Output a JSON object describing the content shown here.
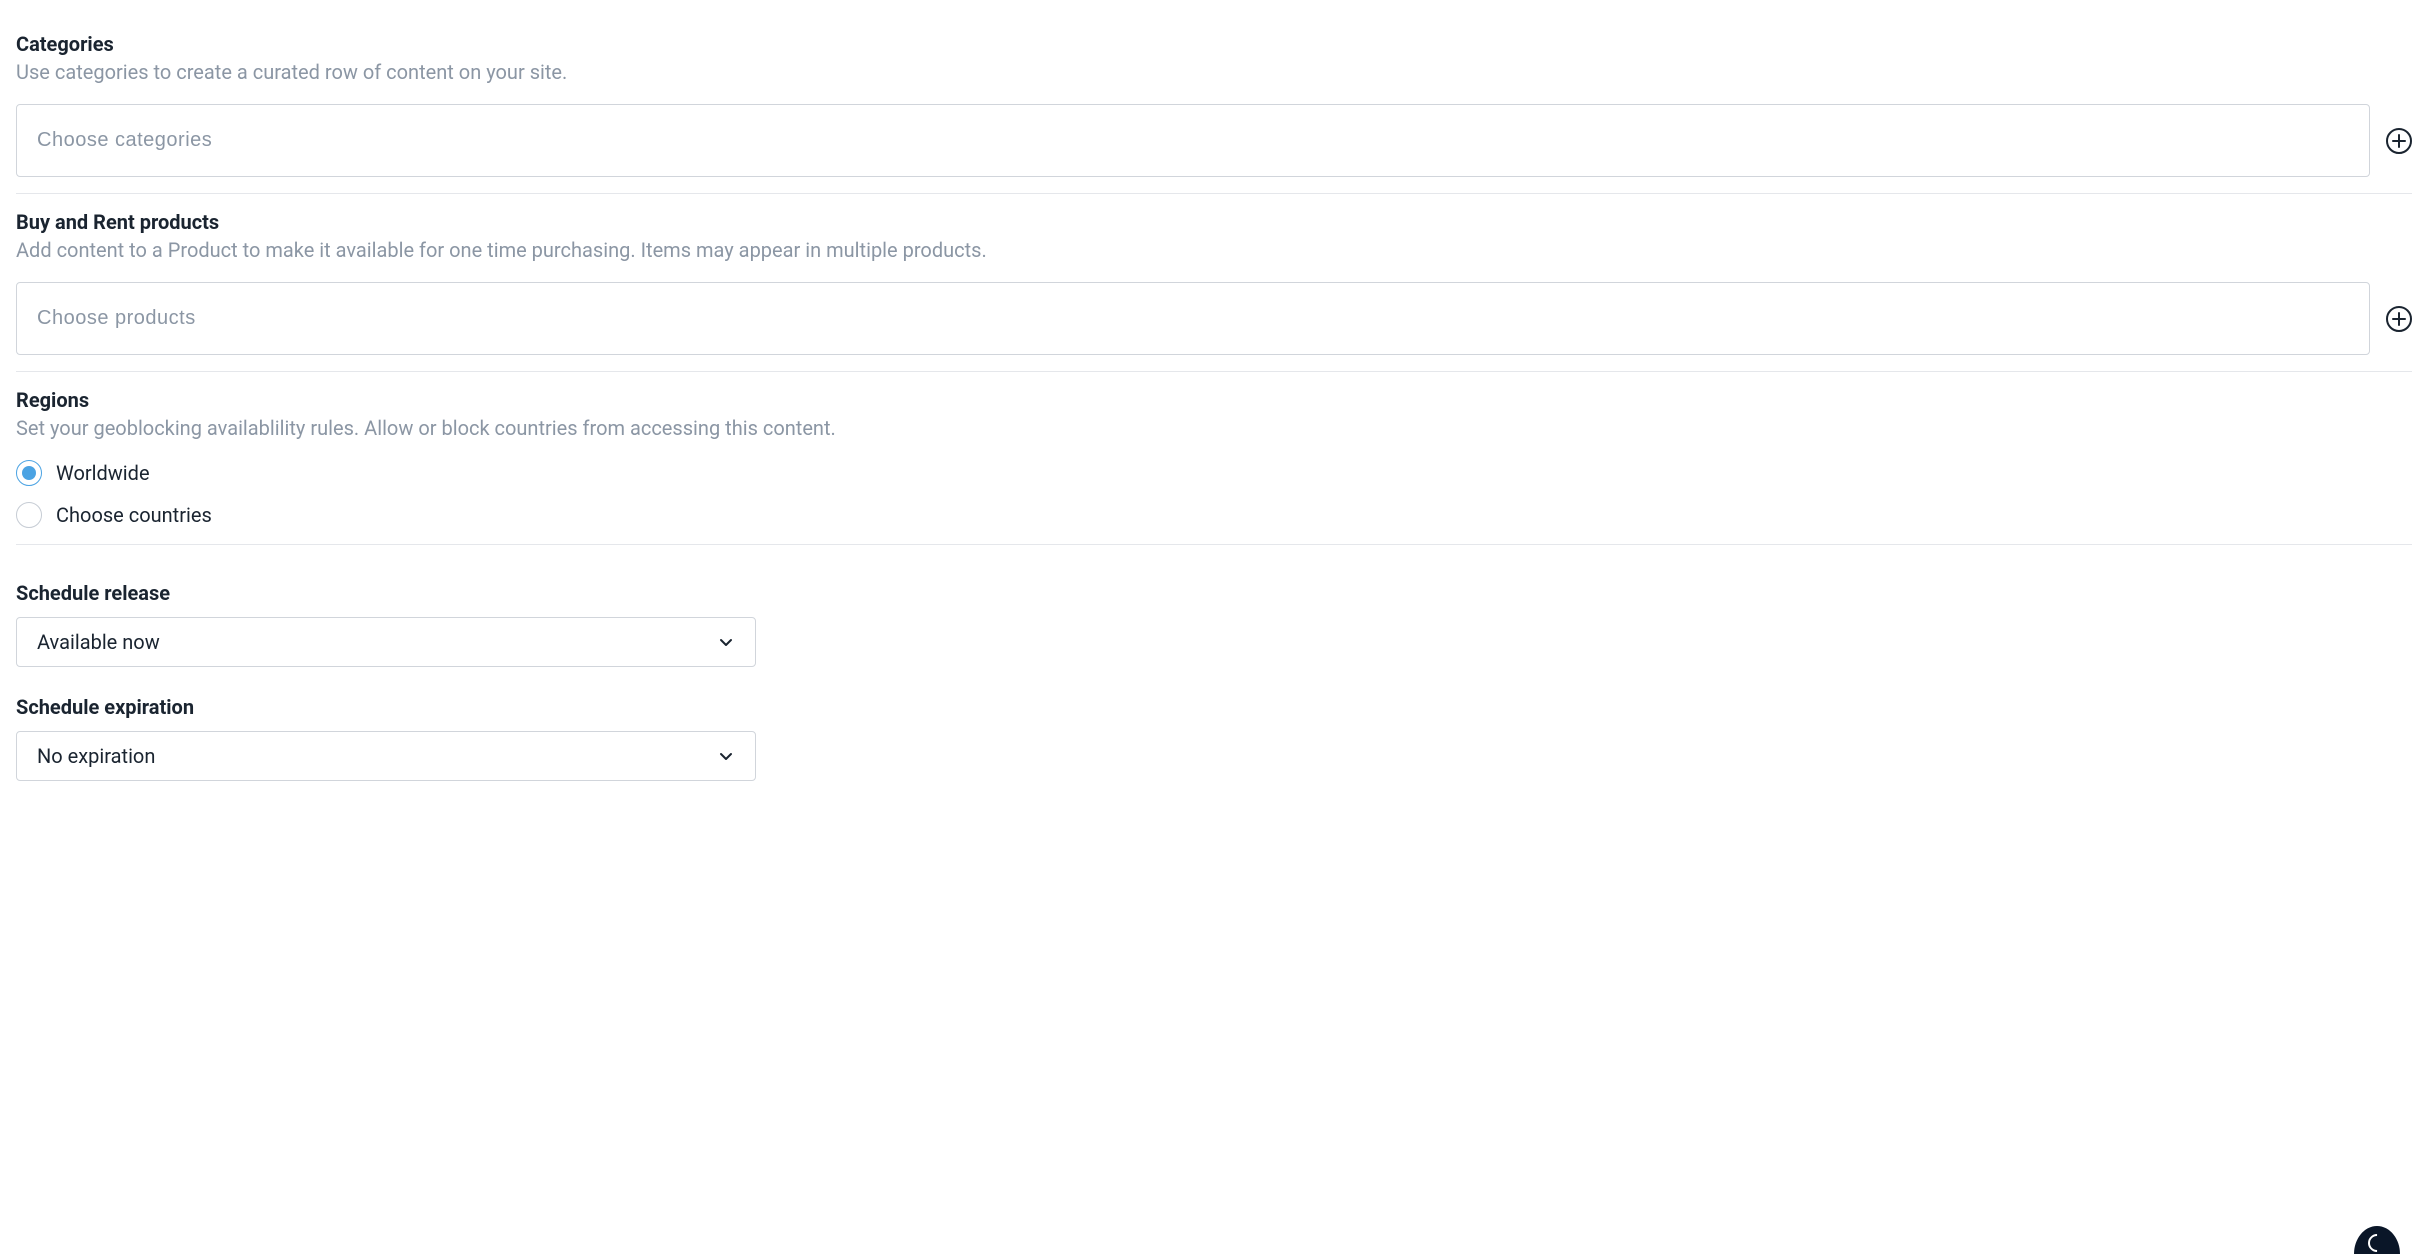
{
  "categories": {
    "title": "Categories",
    "description": "Use categories to create a curated row of content on your site.",
    "placeholder": "Choose categories"
  },
  "products": {
    "title": "Buy and Rent products",
    "description": "Add content to a Product to make it available for one time purchasing. Items may appear in multiple products.",
    "placeholder": "Choose products"
  },
  "regions": {
    "title": "Regions",
    "description": "Set your geoblocking availablility rules. Allow or block countries from accessing this content.",
    "options": {
      "worldwide": "Worldwide",
      "choose": "Choose countries"
    },
    "selected": "worldwide"
  },
  "schedule": {
    "release": {
      "title": "Schedule release",
      "value": "Available now"
    },
    "expiration": {
      "title": "Schedule expiration",
      "value": "No expiration"
    }
  }
}
